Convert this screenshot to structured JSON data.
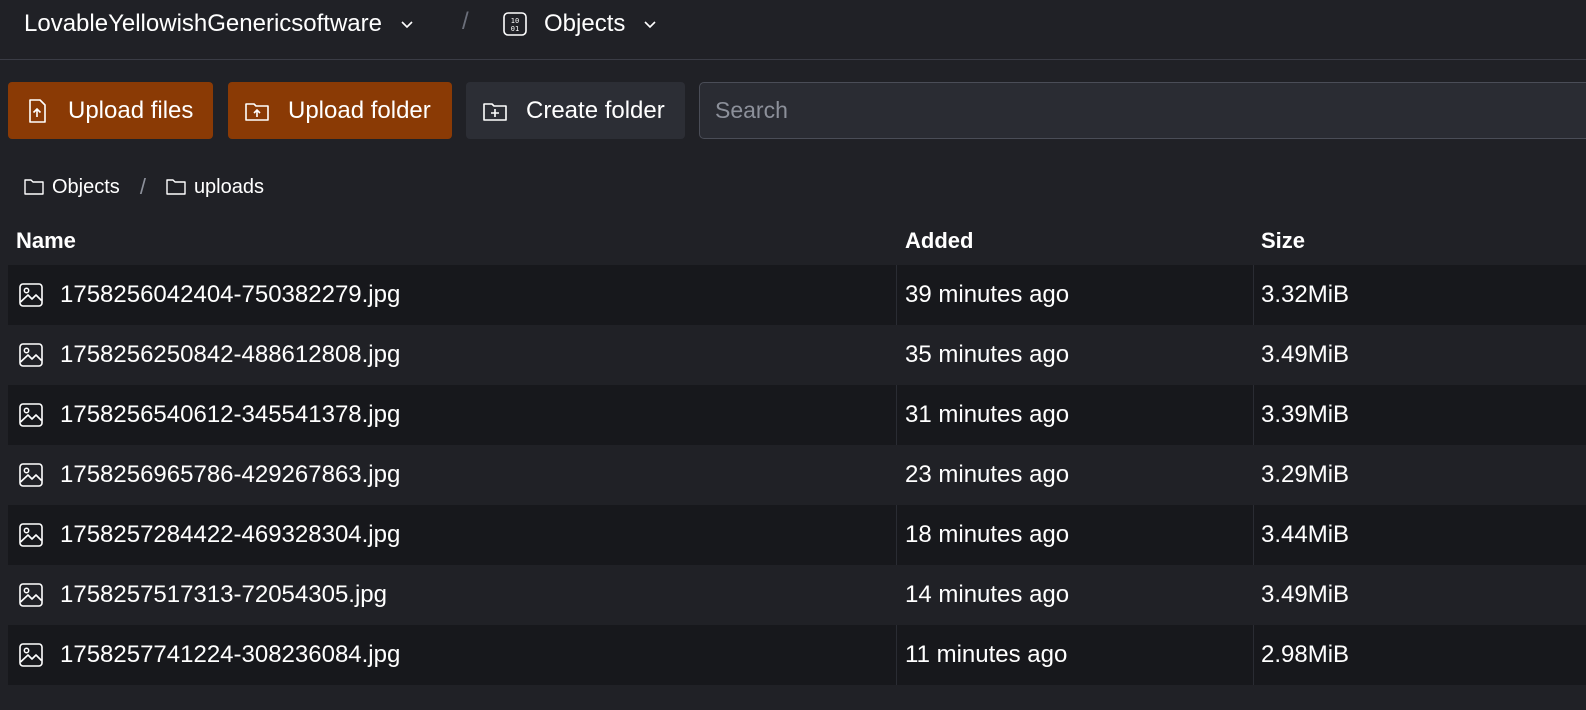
{
  "header": {
    "bucket_name": "LovableYellowishGenericsoftware",
    "separator": "/",
    "section_name": "Objects"
  },
  "toolbar": {
    "upload_files_label": "Upload files",
    "upload_folder_label": "Upload folder",
    "create_folder_label": "Create folder",
    "search_placeholder": "Search"
  },
  "breadcrumb": {
    "items": [
      "Objects",
      "uploads"
    ],
    "separator": "/"
  },
  "table": {
    "columns": [
      "Name",
      "Added",
      "Size"
    ],
    "rows": [
      {
        "name": "1758256042404-750382279.jpg",
        "added": "39 minutes ago",
        "size": "3.32MiB"
      },
      {
        "name": "1758256250842-488612808.jpg",
        "added": "35 minutes ago",
        "size": "3.49MiB"
      },
      {
        "name": "1758256540612-345541378.jpg",
        "added": "31 minutes ago",
        "size": "3.39MiB"
      },
      {
        "name": "1758256965786-429267863.jpg",
        "added": "23 minutes ago",
        "size": "3.29MiB"
      },
      {
        "name": "1758257284422-469328304.jpg",
        "added": "18 minutes ago",
        "size": "3.44MiB"
      },
      {
        "name": "1758257517313-72054305.jpg",
        "added": "14 minutes ago",
        "size": "3.49MiB"
      },
      {
        "name": "1758257741224-308236084.jpg",
        "added": "11 minutes ago",
        "size": "2.98MiB"
      }
    ]
  },
  "icons": {
    "bucket_chevron": "chevron-down-icon",
    "section_icon": "binary-database-icon",
    "upload_files": "file-upload-icon",
    "upload_folder": "folder-upload-icon",
    "create_folder": "folder-plus-icon",
    "breadcrumb_folder": "folder-icon",
    "row_file": "image-file-icon"
  },
  "colors": {
    "background": "#202126",
    "primary_button": "#8a3a05",
    "secondary_button": "#2c2e35",
    "row_alt": "#17181c"
  }
}
